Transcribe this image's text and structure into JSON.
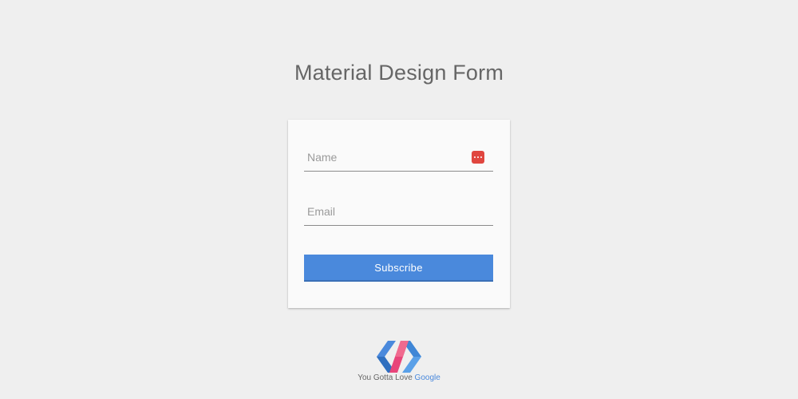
{
  "page": {
    "title": "Material Design Form",
    "background_color": "#efefef"
  },
  "form": {
    "name_field": {
      "placeholder": "Name",
      "value": ""
    },
    "email_field": {
      "placeholder": "Email",
      "value": ""
    },
    "autofill_icon": "password-manager-icon",
    "autofill_icon_color": "#e0463f",
    "subscribe_label": "Subscribe",
    "accent_color": "#4a89dc"
  },
  "footer": {
    "logo": "polymer-logo",
    "text": "You Gotta Love",
    "brand": "Google"
  }
}
